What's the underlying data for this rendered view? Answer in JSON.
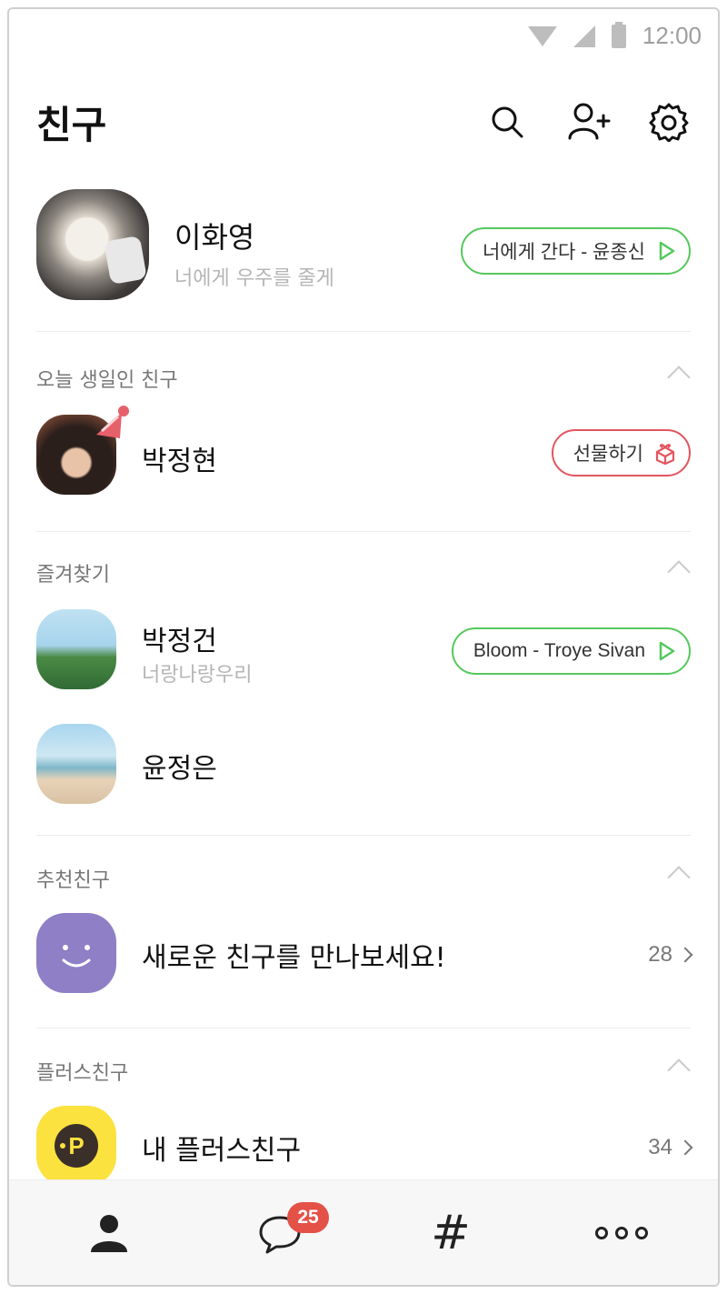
{
  "status_bar": {
    "time": "12:00"
  },
  "header": {
    "title": "친구"
  },
  "icons": {
    "search": "search-icon",
    "add_friend": "add-friend-icon",
    "settings": "gear-icon",
    "play": "play-icon",
    "gift": "gift-icon",
    "chevron_up": "chevron-up-icon",
    "chevron_right": "chevron-right-icon"
  },
  "profile": {
    "name": "이화영",
    "status": "너에게 우주를 줄게",
    "music": "너에게 간다 - 윤종신"
  },
  "sections": {
    "birthday": {
      "title": "오늘 생일인 친구",
      "friend": {
        "name": "박정현",
        "gift_label": "선물하기"
      }
    },
    "favorites": {
      "title": "즐겨찾기",
      "friends": [
        {
          "name": "박정건",
          "status": "너랑나랑우리",
          "music": "Bloom - Troye Sivan"
        },
        {
          "name": "윤정은"
        }
      ]
    },
    "recommended": {
      "title": "추천친구",
      "item": {
        "label": "새로운 친구를 만나보세요!",
        "count": "28"
      }
    },
    "plus": {
      "title": "플러스친구",
      "item": {
        "label": "내 플러스친구",
        "count": "34"
      }
    }
  },
  "bottom_nav": {
    "chat_badge": "25",
    "hash_symbol": "#"
  },
  "colors": {
    "music_border": "#55c85c",
    "gift_border": "#e3555f",
    "badge": "#e45147",
    "recommend_avatar": "#8e7fc6",
    "plus_avatar": "#fbe23f"
  }
}
